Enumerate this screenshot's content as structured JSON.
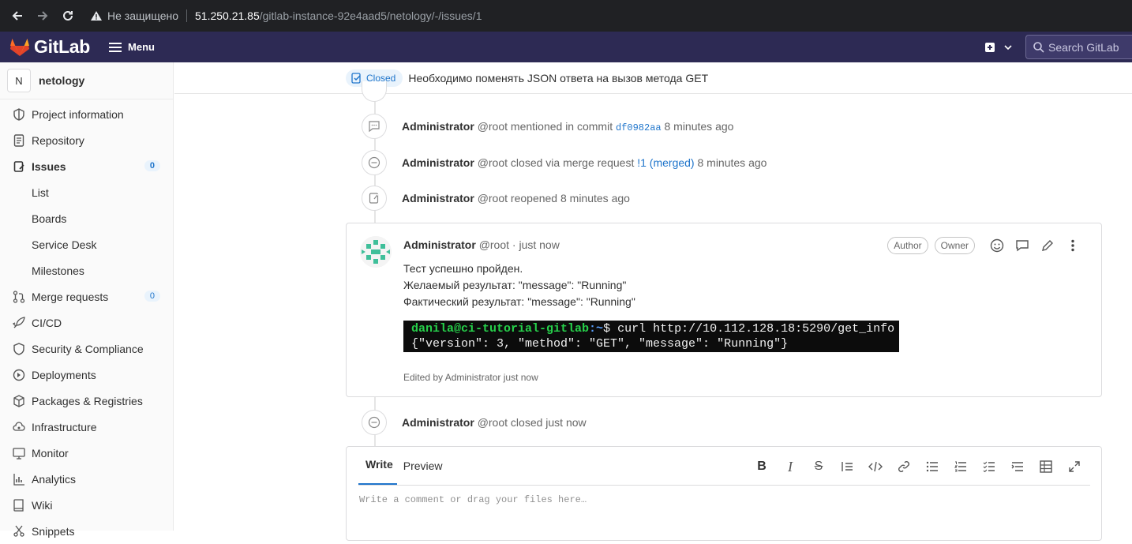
{
  "browser": {
    "insecure_label": "Не защищено",
    "host": "51.250.21.85",
    "path": "/gitlab-instance-92e4aad5/netology/-/issues/1"
  },
  "header": {
    "logo_text": "GitLab",
    "menu_label": "Menu",
    "search_placeholder": "Search GitLab"
  },
  "sidebar": {
    "project_initial": "N",
    "project_name": "netology",
    "items": [
      {
        "label": "Project information",
        "icon": "info-icon"
      },
      {
        "label": "Repository",
        "icon": "doc-icon"
      },
      {
        "label": "Issues",
        "icon": "issues-icon",
        "count": "0"
      },
      {
        "label": "List"
      },
      {
        "label": "Boards"
      },
      {
        "label": "Service Desk"
      },
      {
        "label": "Milestones"
      },
      {
        "label": "Merge requests",
        "icon": "merge-icon",
        "count": "0"
      },
      {
        "label": "CI/CD",
        "icon": "rocket-icon"
      },
      {
        "label": "Security & Compliance",
        "icon": "shield-icon"
      },
      {
        "label": "Deployments",
        "icon": "deploy-icon"
      },
      {
        "label": "Packages & Registries",
        "icon": "package-icon"
      },
      {
        "label": "Infrastructure",
        "icon": "cloud-icon"
      },
      {
        "label": "Monitor",
        "icon": "monitor-icon"
      },
      {
        "label": "Analytics",
        "icon": "chart-icon"
      },
      {
        "label": "Wiki",
        "icon": "book-icon"
      },
      {
        "label": "Snippets",
        "icon": "snippet-icon"
      }
    ]
  },
  "issue": {
    "status": "Closed",
    "title": "Необходимо поменять JSON ответа на вызов метода GET"
  },
  "events": [
    {
      "author": "Administrator",
      "handle": "@root",
      "text": "mentioned in commit",
      "commit": "df0982aa",
      "time": "8 minutes ago"
    },
    {
      "author": "Administrator",
      "handle": "@root",
      "text": "closed via merge request",
      "link": "!1 (merged)",
      "time": "8 minutes ago"
    },
    {
      "author": "Administrator",
      "handle": "@root",
      "text": "reopened",
      "time": "8 minutes ago"
    },
    {
      "author": "Administrator",
      "handle": "@root",
      "text": "closed",
      "time": "just now"
    }
  ],
  "note": {
    "author": "Administrator",
    "meta": "@root · just now",
    "role_author": "Author",
    "role_owner": "Owner",
    "line1": "Тест успешно пройден.",
    "line2": "Желаемый результат: \"message\": \"Running\"",
    "line3": "Фактический результат: \"message\": \"Running\"",
    "term_user": "danila@ci-tutorial-gitlab",
    "term_path": ":~",
    "term_cmd": "$ curl http://10.112.128.18:5290/get_info",
    "term_output": "{\"version\": 3, \"method\": \"GET\", \"message\": \"Running\"}",
    "edited": "Edited by Administrator just now"
  },
  "form": {
    "tab_write": "Write",
    "tab_preview": "Preview",
    "placeholder": "Write a comment or drag your files here…"
  }
}
